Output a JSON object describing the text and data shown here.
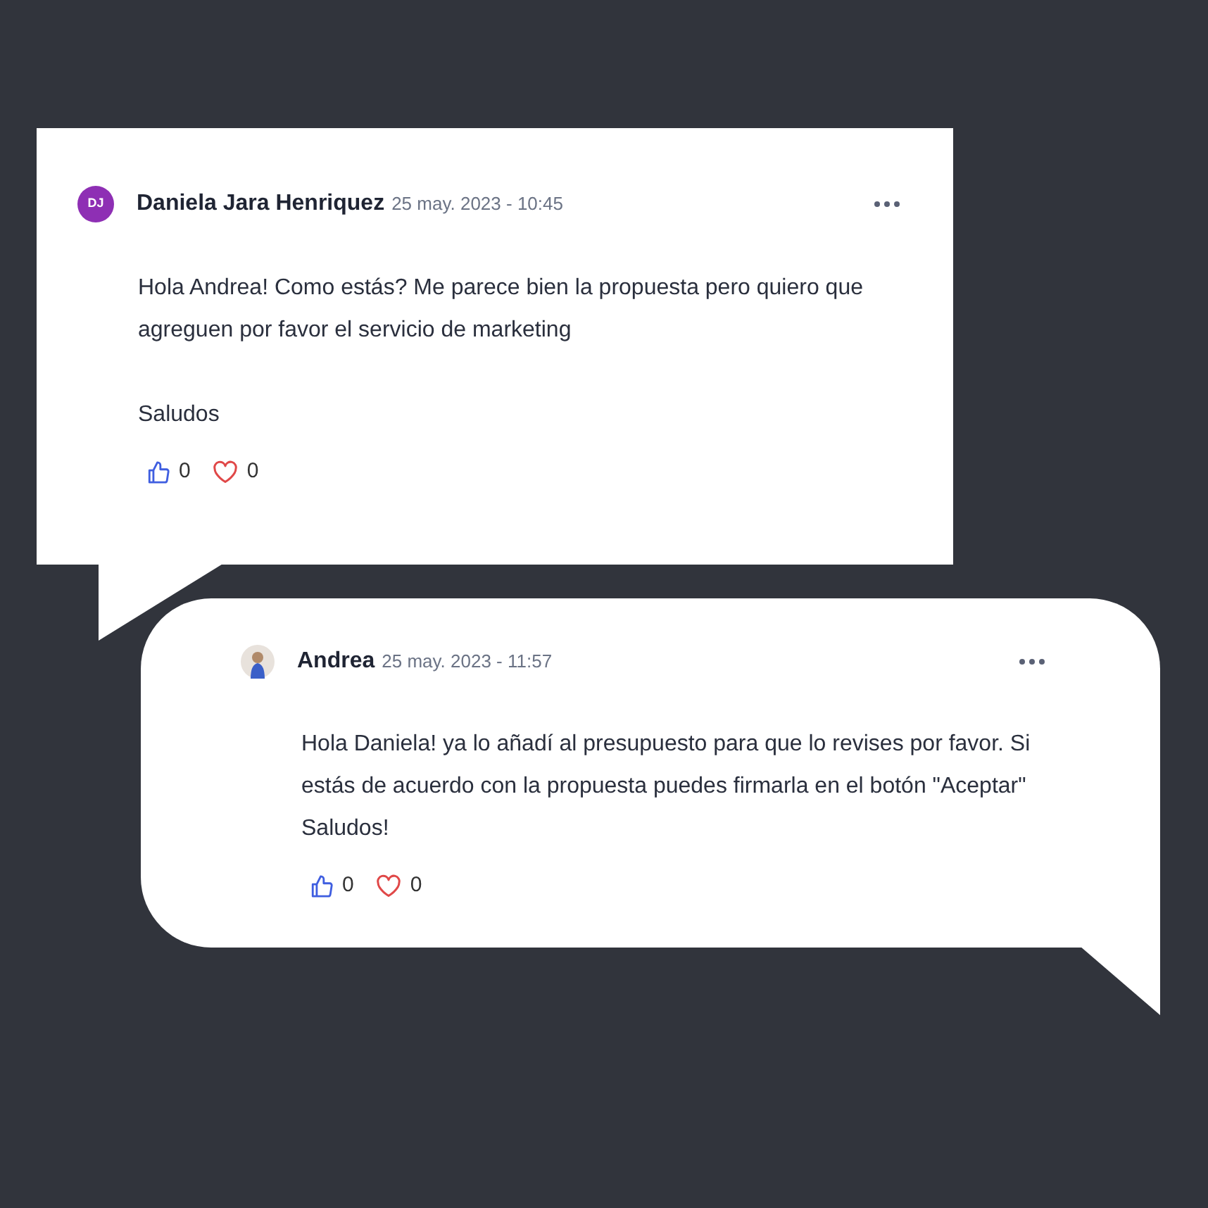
{
  "comments": [
    {
      "avatar": {
        "kind": "initials",
        "initials": "DJ",
        "color": "#8e2fb4"
      },
      "author": "Daniela Jara Henriquez",
      "date": "25 may. 2023 - 10:45",
      "text": "Hola Andrea! Como estás? Me parece bien la propuesta pero quiero que agreguen por favor el servicio de marketing\n\nSaludos",
      "likes": "0",
      "hearts": "0"
    },
    {
      "avatar": {
        "kind": "photo"
      },
      "author": "Andrea",
      "date": "25 may. 2023 - 11:57",
      "text": "Hola Daniela! ya lo añadí al presupuesto para que lo revises por favor. Si estás de acuerdo con la propuesta puedes firmarla en el botón \"Aceptar\" Saludos!",
      "likes": "0",
      "hearts": "0"
    }
  ]
}
